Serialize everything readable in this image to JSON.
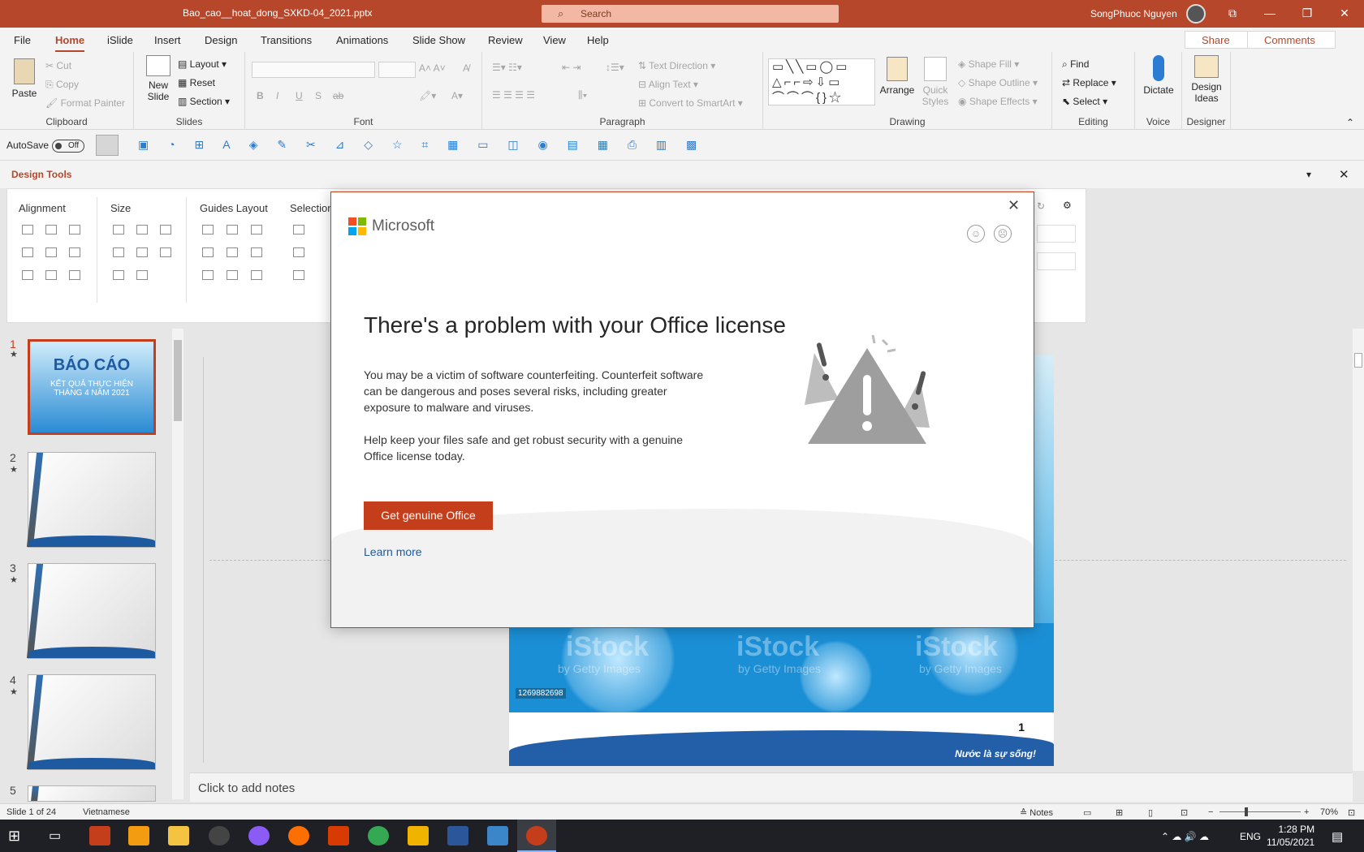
{
  "titlebar": {
    "filename": "Bao_cao__hoat_dong_SXKD-04_2021.pptx",
    "search_placeholder": "Search",
    "user_name": "SongPhuoc Nguyen"
  },
  "menu": {
    "tabs": [
      "File",
      "Home",
      "iSlide",
      "Insert",
      "Design",
      "Transitions",
      "Animations",
      "Slide Show",
      "Review",
      "View",
      "Help"
    ],
    "share_label": "Share",
    "comments_label": "Comments"
  },
  "ribbon": {
    "clipboard": {
      "paste": "Paste",
      "cut": "Cut",
      "copy": "Copy",
      "format_painter": "Format Painter",
      "label": "Clipboard"
    },
    "slides": {
      "new_slide_line1": "New",
      "new_slide_line2": "Slide",
      "layout": "Layout",
      "reset": "Reset",
      "section": "Section",
      "label": "Slides"
    },
    "font": {
      "label": "Font",
      "bold": "B",
      "italic": "I",
      "underline": "U",
      "shadow": "S",
      "strike": "ab"
    },
    "paragraph": {
      "label": "Paragraph",
      "text_direction": "Text Direction",
      "align_text": "Align Text",
      "convert_smartart": "Convert to SmartArt"
    },
    "drawing": {
      "label": "Drawing",
      "arrange": "Arrange",
      "quick_styles_line1": "Quick",
      "quick_styles_line2": "Styles",
      "shape_fill": "Shape Fill",
      "shape_outline": "Shape Outline",
      "shape_effects": "Shape Effects"
    },
    "editing": {
      "label": "Editing",
      "find": "Find",
      "replace": "Replace",
      "select": "Select"
    },
    "voice": {
      "label": "Voice",
      "dictate": "Dictate"
    },
    "designer": {
      "label": "Designer",
      "design_ideas_line1": "Design",
      "design_ideas_line2": "Ideas"
    }
  },
  "qat": {
    "autosave_label": "AutoSave",
    "autosave_state": "Off"
  },
  "design_tools": {
    "title": "Design Tools",
    "sections": [
      "Alignment",
      "Size",
      "Guides Layout",
      "Selection"
    ]
  },
  "slides_pane": {
    "slides": [
      {
        "number": "1",
        "thumb_title": "BÁO CÁO",
        "thumb_subtitle": "KẾT QUẢ THỰC HIỆN",
        "thumb_line3": "THÁNG 4 NĂM 2021"
      },
      {
        "number": "2"
      },
      {
        "number": "3"
      },
      {
        "number": "4"
      },
      {
        "number": "5"
      }
    ]
  },
  "slide": {
    "page_number": "1",
    "motto": "Nước là sự sống!",
    "stock_id": "1269882698",
    "watermark": "iStock",
    "watermark_sub": "by Getty Images"
  },
  "notes_placeholder": "Click to add notes",
  "status": {
    "slide_counter": "Slide 1 of 24",
    "language": "Vietnamese",
    "notes_label": "Notes",
    "zoom": "70%"
  },
  "taskbar": {
    "time": "1:28 PM",
    "date": "11/05/2021",
    "lang": "ENG"
  },
  "dialog": {
    "brand": "Microsoft",
    "title": "There's a problem with your Office license",
    "para1": "You may be a victim of software counterfeiting. Counterfeit software can be dangerous and poses several risks, including greater exposure to malware and viruses.",
    "para2": "Help keep your files safe and get robust security with a genuine Office license today.",
    "primary_button": "Get genuine Office",
    "link": "Learn more"
  },
  "colors": {
    "accent": "#b7472a",
    "button": "#c43e1c",
    "link": "#1e5aa0"
  }
}
